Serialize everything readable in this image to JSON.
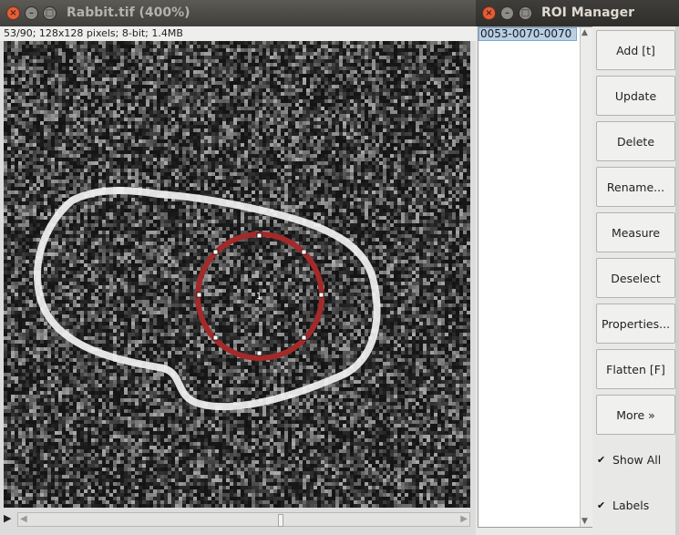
{
  "image_window": {
    "title": "Rabbit.tif (400%)",
    "info": "53/90; 128x128 pixels; 8-bit; 1.4MB",
    "roi_label": "1",
    "colors": {
      "roi_stroke": "#a32a2a",
      "contour": "#f2f2f2"
    }
  },
  "roi_manager": {
    "title": "ROI Manager",
    "list": [
      "0053-0070-0070"
    ],
    "buttons": [
      "Add [t]",
      "Update",
      "Delete",
      "Rename...",
      "Measure",
      "Deselect",
      "Properties...",
      "Flatten [F]",
      "More »"
    ],
    "checkboxes": [
      {
        "label": "Show All",
        "checked": true
      },
      {
        "label": "Labels",
        "checked": true
      }
    ]
  }
}
